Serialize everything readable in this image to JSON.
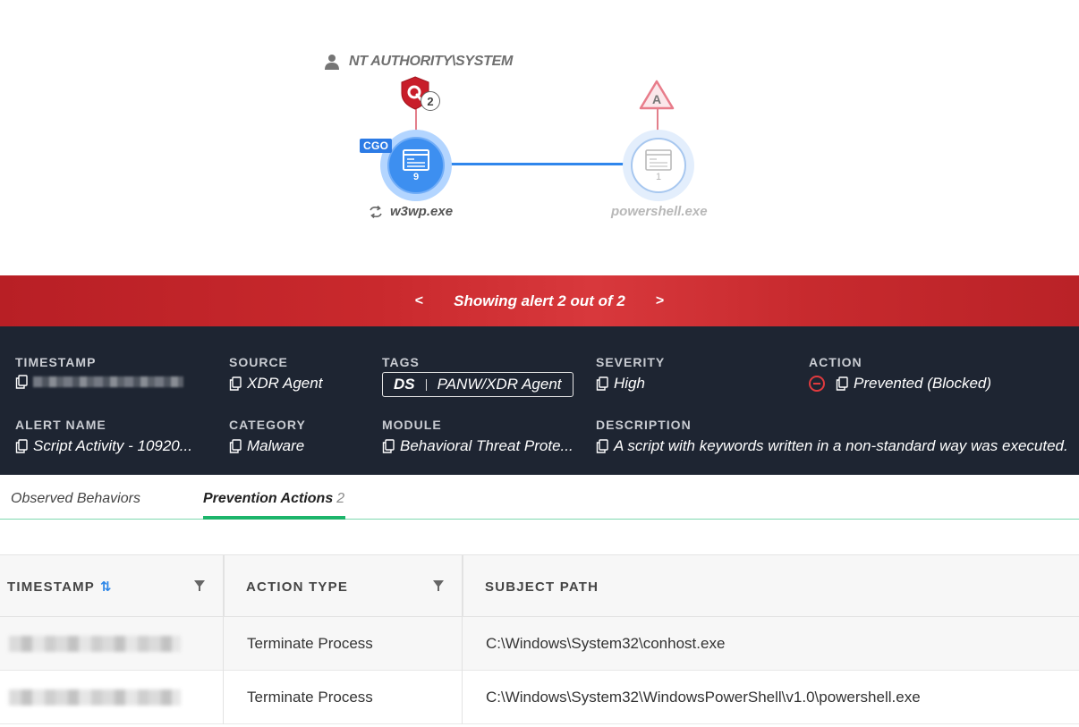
{
  "graph": {
    "user": "NT AUTHORITY\\SYSTEM",
    "shield_count": "2",
    "alert_marker": "A",
    "main_node": {
      "badge": "CGO",
      "count": "9",
      "label": "w3wp.exe"
    },
    "child_node": {
      "count": "1",
      "label": "powershell.exe"
    }
  },
  "banner": {
    "prev": "<",
    "title": "Showing alert 2 out of 2",
    "next": ">"
  },
  "details": {
    "timestamp": {
      "label": "TIMESTAMP",
      "value": ""
    },
    "source": {
      "label": "SOURCE",
      "value": "XDR Agent"
    },
    "tags": {
      "label": "TAGS",
      "prefix": "DS",
      "value": "PANW/XDR Agent"
    },
    "severity": {
      "label": "SEVERITY",
      "value": "High"
    },
    "action": {
      "label": "ACTION",
      "value": "Prevented (Blocked)"
    },
    "alert_name": {
      "label": "ALERT NAME",
      "value": "Script Activity - 10920..."
    },
    "category": {
      "label": "CATEGORY",
      "value": "Malware"
    },
    "module": {
      "label": "MODULE",
      "value": "Behavioral Threat Prote..."
    },
    "description": {
      "label": "DESCRIPTION",
      "value": "A script with keywords written in a non-standard way was executed."
    }
  },
  "tabs": [
    {
      "label": "Observed Behaviors",
      "badge": ""
    },
    {
      "label": "Prevention Actions",
      "badge": "2"
    }
  ],
  "table": {
    "columns": [
      "TIMESTAMP",
      "ACTION TYPE",
      "SUBJECT PATH"
    ],
    "rows": [
      {
        "timestamp": "",
        "action_type": "Terminate Process",
        "subject_path": "C:\\Windows\\System32\\conhost.exe"
      },
      {
        "timestamp": "",
        "action_type": "Terminate Process",
        "subject_path": "C:\\Windows\\System32\\WindowsPowerShell\\v1.0\\powershell.exe"
      }
    ]
  },
  "colors": {
    "banner_red": "#c9292d",
    "panel_bg": "#1e2532",
    "node_blue": "#3d8ff0",
    "tab_green": "#1db56b",
    "sort_blue": "#2c86e8",
    "prevent_red": "#e03a3e"
  }
}
